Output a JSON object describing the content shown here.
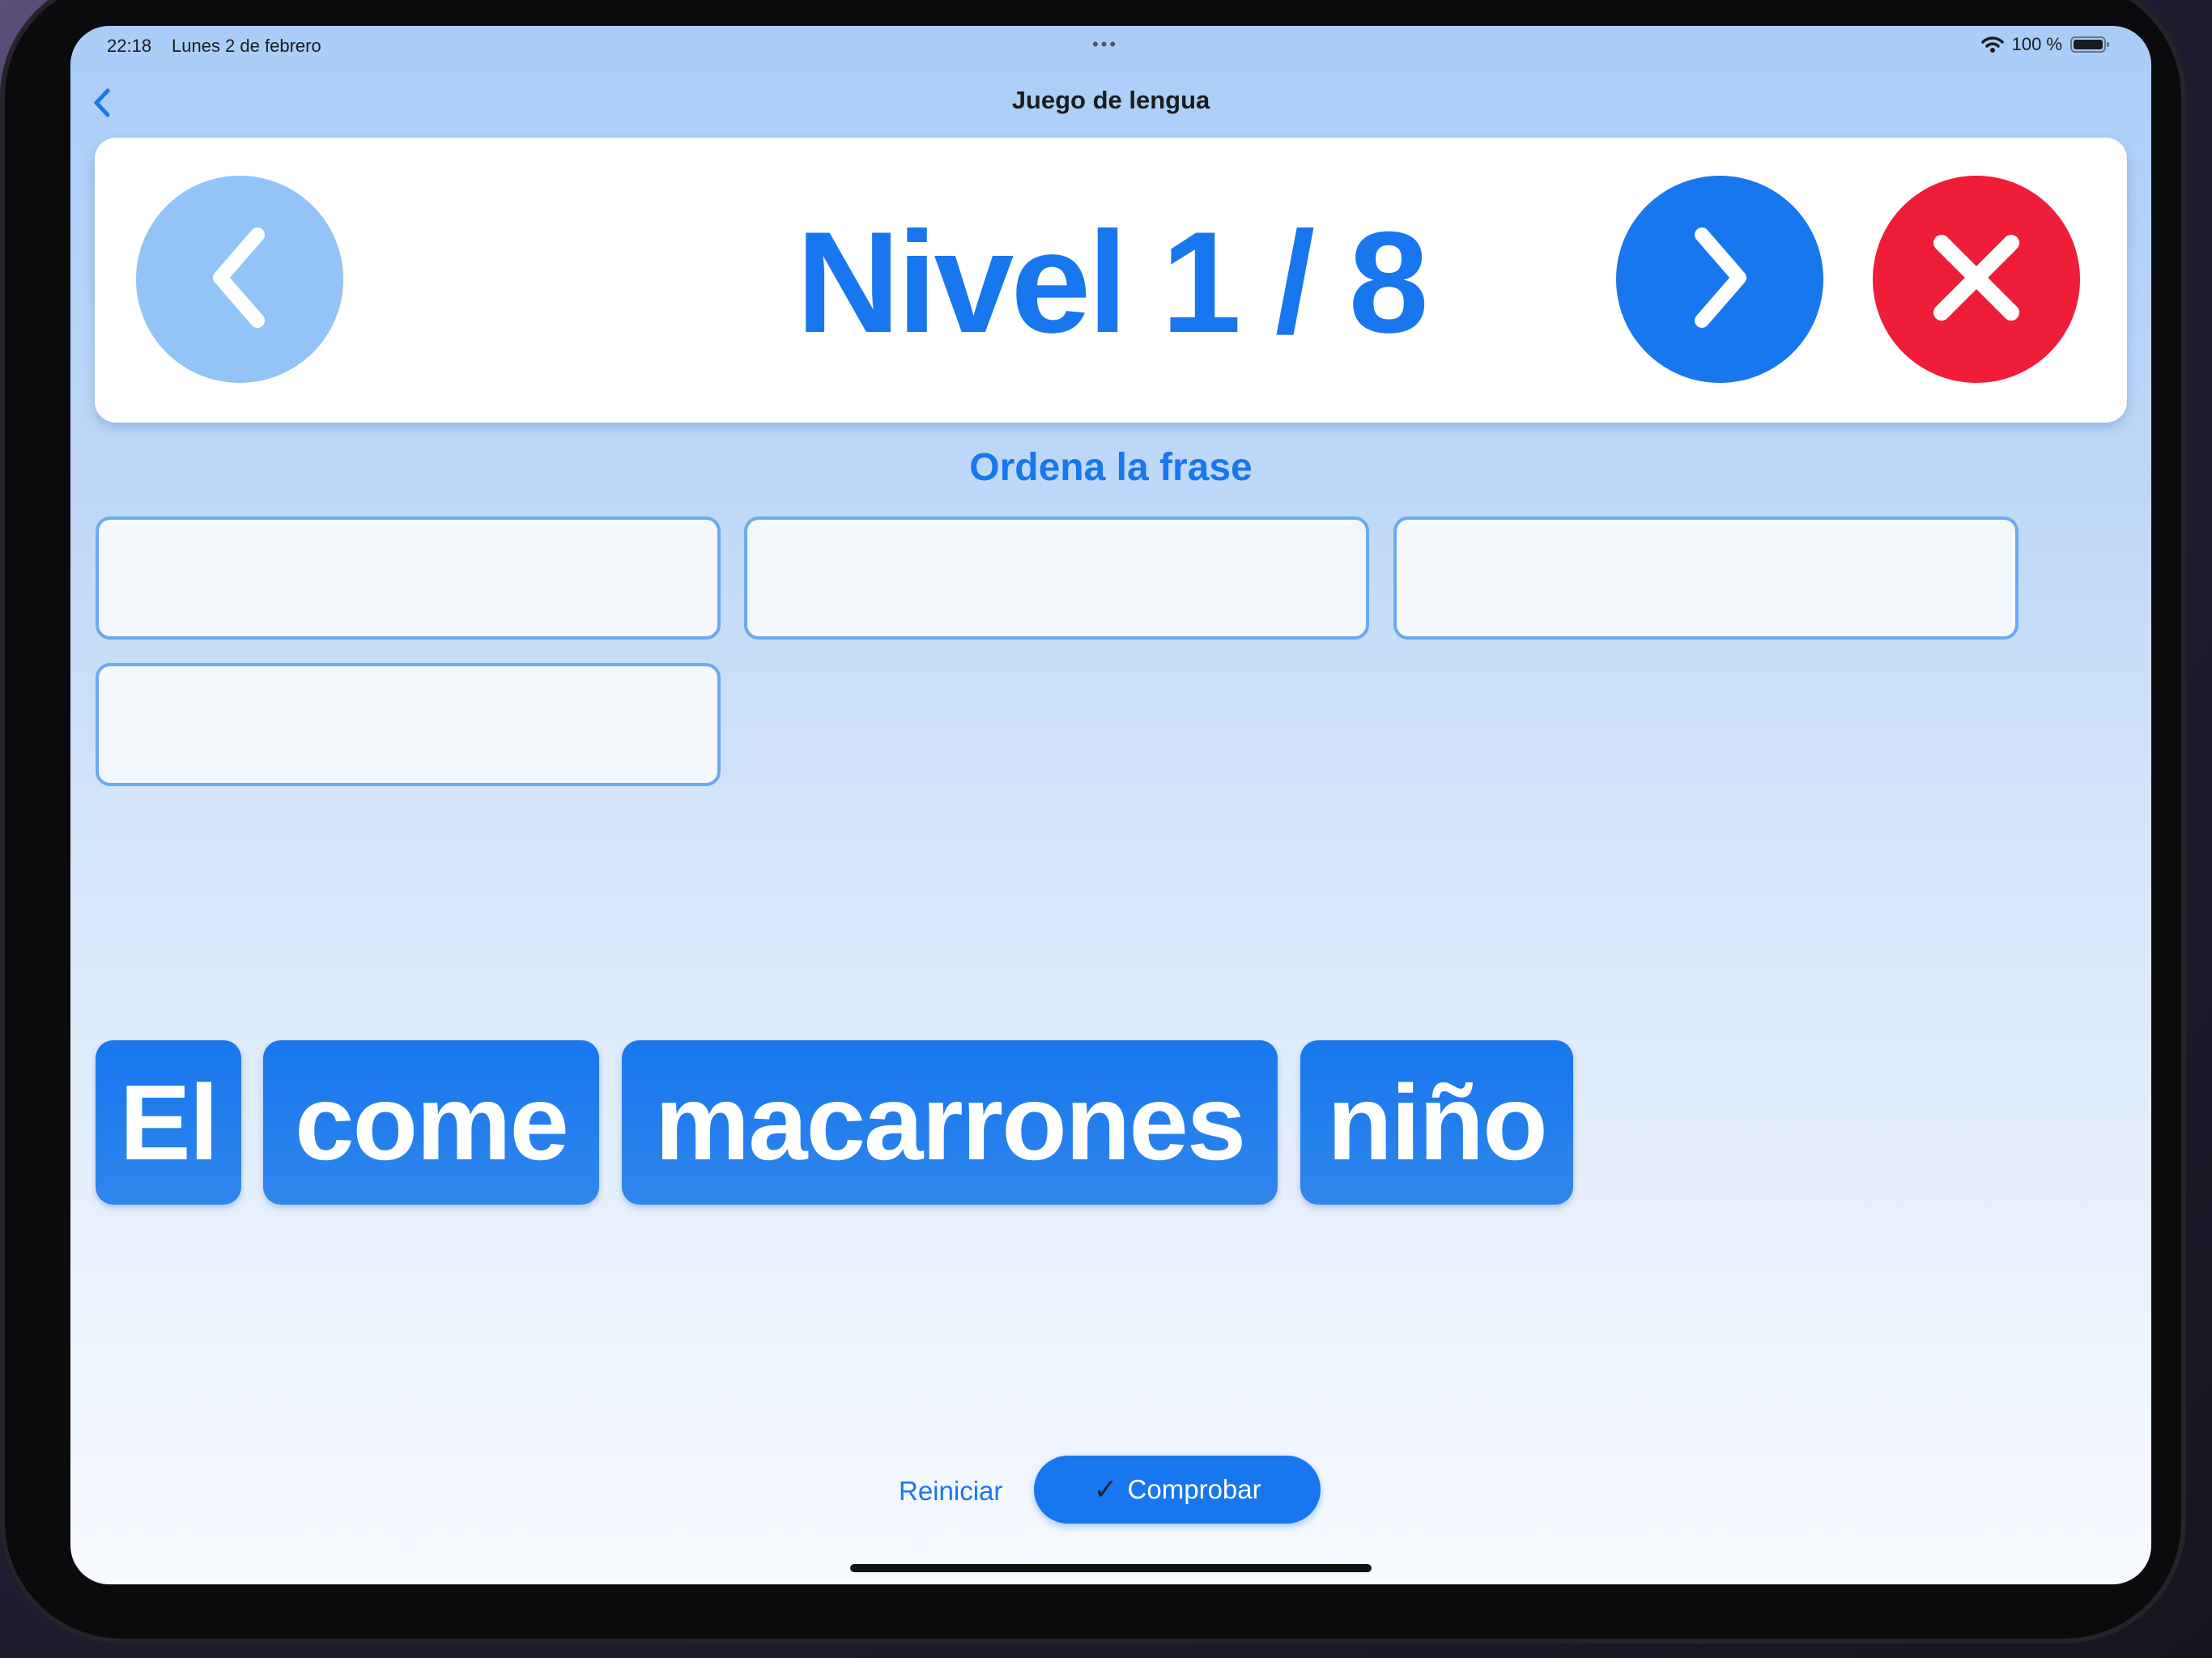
{
  "status_bar": {
    "time": "22:18",
    "date": "Lunes 2 de febrero",
    "dots": "•••",
    "battery_text": "100 %"
  },
  "nav": {
    "back_icon": "chevron-left-icon",
    "title": "Juego de lengua"
  },
  "level": {
    "title": "Nivel 1 / 8",
    "prev_icon": "chevron-left-icon",
    "next_icon": "chevron-right-icon",
    "close_icon": "close-icon"
  },
  "instruction": "Ordena la frase",
  "slots": [
    "",
    "",
    "",
    ""
  ],
  "words": [
    "El",
    "come",
    "macarrones",
    "niño"
  ],
  "actions": {
    "reset_label": "Reiniciar",
    "check_label": "Comprobar",
    "check_icon": "checkmark-icon"
  },
  "colors": {
    "accent": "#1877ee",
    "accent_light": "#92c4f7",
    "danger": "#f01d39"
  }
}
